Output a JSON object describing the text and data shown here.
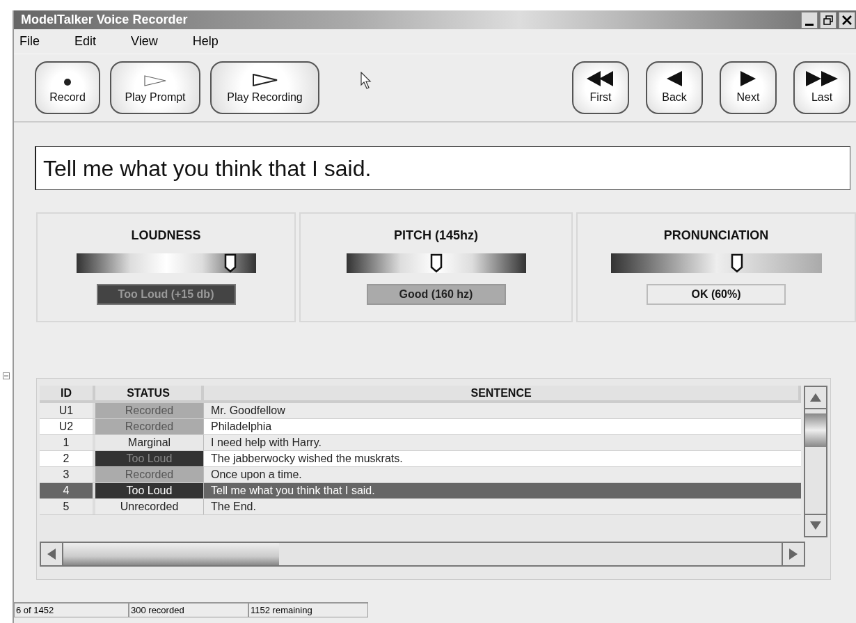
{
  "window": {
    "title": "ModelTalker Voice Recorder"
  },
  "menu": [
    "File",
    "Edit",
    "View",
    "Help"
  ],
  "toolbar": {
    "left": [
      {
        "kind": "record",
        "label": "Record"
      },
      {
        "kind": "play_prompt",
        "label": "Play Prompt"
      },
      {
        "kind": "play_recording",
        "label": "Play Recording"
      }
    ],
    "right": [
      {
        "kind": "first",
        "label": "First"
      },
      {
        "kind": "back",
        "label": "Back"
      },
      {
        "kind": "next",
        "label": "Next"
      },
      {
        "kind": "last",
        "label": "Last"
      }
    ]
  },
  "prompt": "Tell me what you think that I said.",
  "meters": [
    {
      "title": "LOUDNESS",
      "level": 0.86,
      "right_end_dark": true,
      "reading": "Too Loud (+15 db)",
      "kind": "too_loud"
    },
    {
      "title": "PITCH (145hz)",
      "level": 0.5,
      "right_end_dark": true,
      "reading": "Good (160 hz)",
      "kind": "good"
    },
    {
      "title": "PRONUNCIATION",
      "level": 0.6,
      "right_end_dark": false,
      "reading": "OK (60%)",
      "kind": "ok"
    }
  ],
  "table": {
    "columns": [
      "ID",
      "STATUS",
      "SENTENCE"
    ],
    "rows": [
      {
        "id": "U1",
        "status": "Recorded",
        "kind": "recorded",
        "sentence": "Mr. Goodfellow",
        "selected": false
      },
      {
        "id": "U2",
        "status": "Recorded",
        "kind": "recorded",
        "sentence": "Philadelphia",
        "selected": false
      },
      {
        "id": "1",
        "status": "Marginal",
        "kind": "marginal",
        "sentence": "I need help with Harry.",
        "selected": false
      },
      {
        "id": "2",
        "status": "Too Loud",
        "kind": "too_loud",
        "sentence": "The jabberwocky wished the muskrats.",
        "selected": false
      },
      {
        "id": "3",
        "status": "Recorded",
        "kind": "recorded",
        "sentence": "Once upon a time.",
        "selected": false
      },
      {
        "id": "4",
        "status": "Too Loud",
        "kind": "too_loud",
        "sentence": "Tell me what you think that I said.",
        "selected": true
      },
      {
        "id": "5",
        "status": "Unrecorded",
        "kind": "unrecorded",
        "sentence": "The End.",
        "selected": false
      }
    ]
  },
  "status_bar": [
    "6 of 1452",
    "300 recorded",
    "1152 remaining"
  ]
}
